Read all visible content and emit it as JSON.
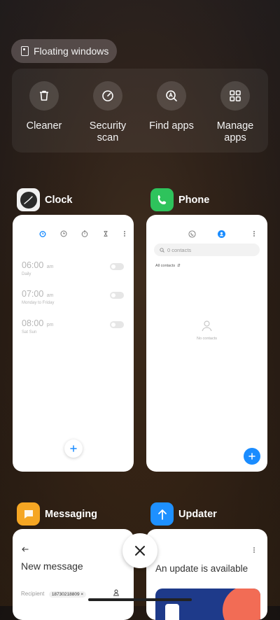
{
  "floating_windows": {
    "label": "Floating windows"
  },
  "quick_tools": [
    {
      "label": "Cleaner",
      "icon": "trash-icon"
    },
    {
      "label": "Security\nscan",
      "icon": "security-scan-icon"
    },
    {
      "label": "Find apps",
      "icon": "find-apps-icon"
    },
    {
      "label": "Manage\napps",
      "icon": "manage-apps-icon"
    }
  ],
  "recent_apps": {
    "clock": {
      "name": "Clock",
      "alarms": [
        {
          "time": "06:00",
          "ampm": "am",
          "repeat": "Daily"
        },
        {
          "time": "07:00",
          "ampm": "am",
          "repeat": "Monday to Friday"
        },
        {
          "time": "08:00",
          "ampm": "pm",
          "repeat": "Sat Sun"
        }
      ]
    },
    "phone": {
      "name": "Phone",
      "search_placeholder": "0 contacts",
      "filter": "All contacts",
      "empty": "No contacts"
    },
    "messaging": {
      "name": "Messaging",
      "title": "New message",
      "recipient_label": "Recipient",
      "recipient_value": "18730218809"
    },
    "updater": {
      "name": "Updater",
      "message": "An update is available"
    }
  },
  "colors": {
    "clock_accent": "#1a8cff",
    "phone_icon": "#2ec35c",
    "messaging_icon": "#f5a623",
    "updater_icon": "#1e90ff"
  }
}
